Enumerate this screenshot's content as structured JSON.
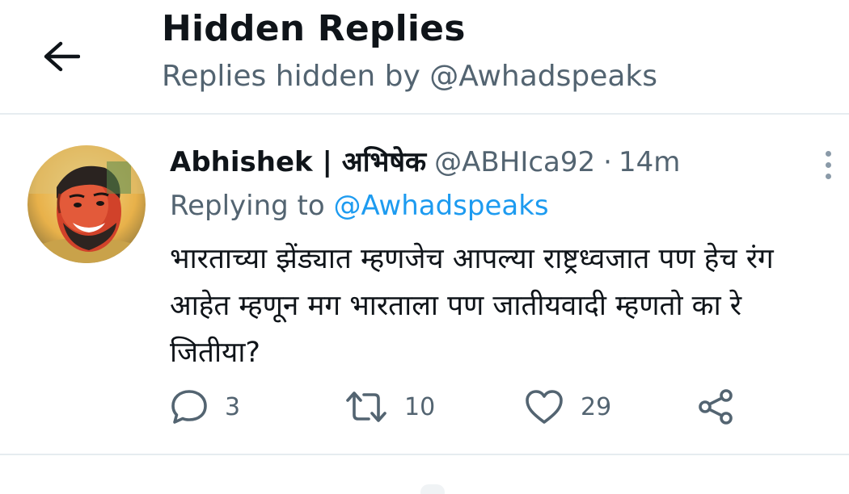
{
  "header": {
    "title": "Hidden Replies",
    "subtitle": "Replies hidden by @Awhadspeaks",
    "back_icon": "arrow-left-icon"
  },
  "tweet": {
    "display_name": "Abhishek | अभिषेक",
    "handle": "@ABHIca92",
    "separator": "·",
    "time": "14m",
    "replying_prefix": "Replying to",
    "replying_to": "@Awhadspeaks",
    "text": "भारताच्या झेंड्यात म्हणजेच आपल्या राष्ट्रध्वजात पण हेच रंग आहेत म्हणून मग भारताला पण जातीयवादी म्हणतो का रे जितीया?",
    "more_icon": "more-vertical-icon",
    "actions": {
      "reply": {
        "icon": "reply-bubble-icon",
        "count": "3"
      },
      "retweet": {
        "icon": "retweet-icon",
        "count": "10"
      },
      "like": {
        "icon": "heart-icon",
        "count": "29"
      },
      "share": {
        "icon": "share-icon"
      }
    }
  },
  "colors": {
    "link_blue": "#1d9bf0",
    "secondary_text": "#536471",
    "primary_text": "#0f1419",
    "divider": "#e6ecf0"
  }
}
